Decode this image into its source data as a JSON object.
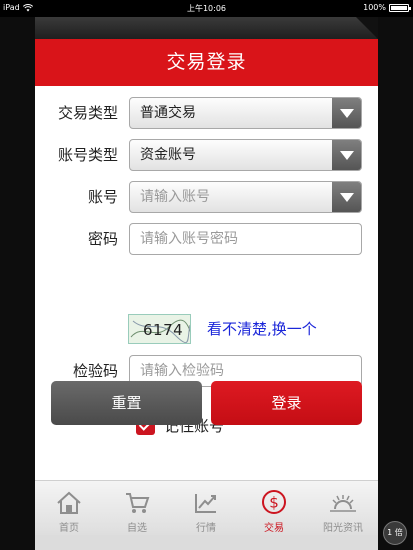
{
  "status_bar": {
    "device": "iPad",
    "time": "上午10:06",
    "battery": "100%",
    "battery_level": 1.0
  },
  "header": {
    "title": "交易登录"
  },
  "form": {
    "trade_type": {
      "label": "交易类型",
      "value": "普通交易"
    },
    "account_type": {
      "label": "账号类型",
      "value": "资金账号"
    },
    "account": {
      "label": "账号",
      "placeholder": "请输入账号"
    },
    "password": {
      "label": "密码",
      "placeholder": "请输入账号密码"
    },
    "captcha": {
      "code": "6174",
      "refresh_text": "看不清楚,换一个"
    },
    "verify": {
      "label": "检验码",
      "placeholder": "请输入检验码"
    },
    "remember": {
      "label": "记住账号",
      "checked": true
    }
  },
  "buttons": {
    "reset": "重置",
    "login": "登录"
  },
  "tabbar": {
    "items": [
      {
        "label": "首页",
        "icon": "home-icon"
      },
      {
        "label": "自选",
        "icon": "cart-icon"
      },
      {
        "label": "行情",
        "icon": "chart-icon"
      },
      {
        "label": "交易",
        "icon": "dollar-icon",
        "active": true
      },
      {
        "label": "阳光资讯",
        "icon": "sun-icon"
      }
    ]
  },
  "zoom": {
    "label": "1 倍"
  },
  "colors": {
    "accent": "#d91419",
    "link": "#1c27d9",
    "tab_inactive": "#8e8e8e"
  }
}
